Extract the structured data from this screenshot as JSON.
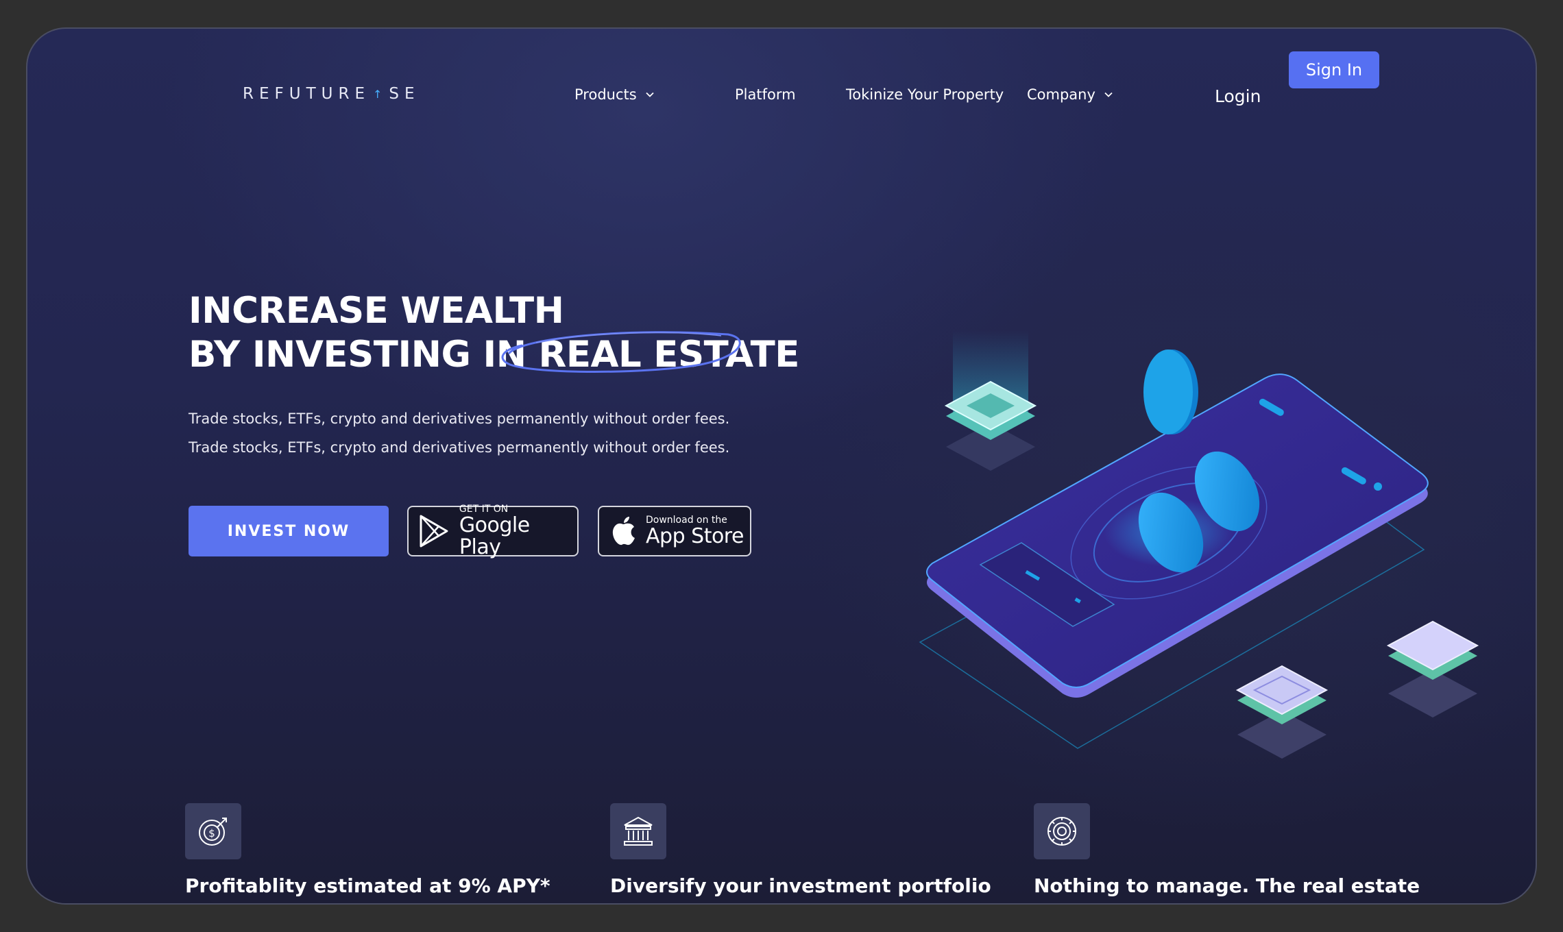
{
  "nav": {
    "logo_left": "REFUTURE",
    "logo_right": "SE",
    "links": {
      "products": "Products",
      "platform": "Platform",
      "tokenize": "Tokinize Your Property",
      "company": "Company"
    },
    "login": "Login",
    "signin": "Sign In"
  },
  "hero": {
    "title_line1": "INCREASE WEALTH",
    "title_line2_a": "BY INVESTING IN",
    "title_line2_b": "REAL ESTATE",
    "desc_line1": "Trade stocks, ETFs, crypto and derivatives permanently without order fees.",
    "desc_line2": "Trade stocks, ETFs, crypto and derivatives permanently without order fees.",
    "cta": "INVEST NOW"
  },
  "stores": {
    "google_small": "GET IT ON",
    "google_big": "Google Play",
    "apple_small": "Download on the",
    "apple_big": "App Store"
  },
  "features": [
    {
      "icon": "target-dollar-icon",
      "text": "Profitablity estimated at 9% APY*"
    },
    {
      "icon": "bank-building-icon",
      "text": "Diversify your investment portfolio"
    },
    {
      "icon": "gear-cog-icon",
      "text": "Nothing to manage. The real estate"
    }
  ],
  "colors": {
    "accent": "#5670f2",
    "background": "#232650",
    "cyan": "#1ea3e8"
  }
}
